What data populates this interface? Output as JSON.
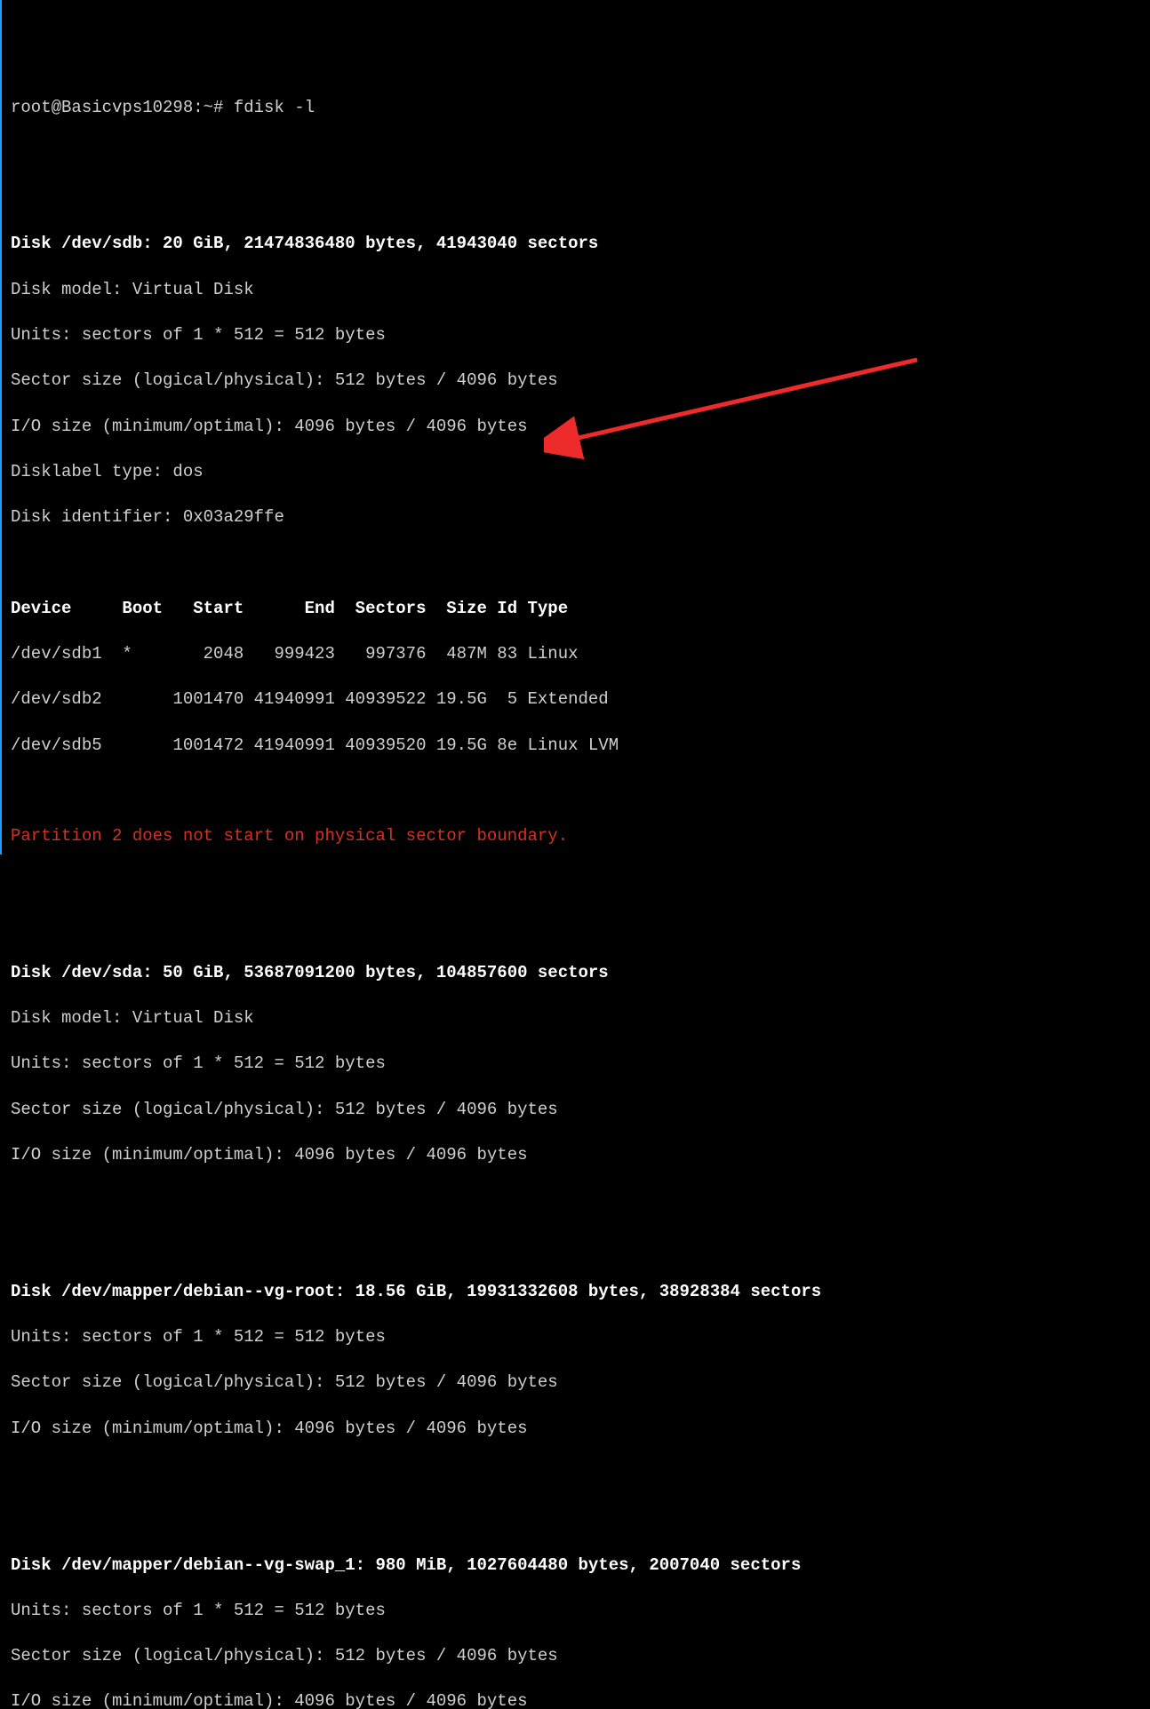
{
  "prompt": "root@Basicvps10298:~# fdisk -l",
  "disk_sdb": {
    "header": "Disk /dev/sdb: 20 GiB, 21474836480 bytes, 41943040 sectors",
    "model": "Disk model: Virtual Disk",
    "units": "Units: sectors of 1 * 512 = 512 bytes",
    "sector": "Sector size (logical/physical): 512 bytes / 4096 bytes",
    "io": "I/O size (minimum/optimal): 4096 bytes / 4096 bytes",
    "label": "Disklabel type: dos",
    "id": "Disk identifier: 0x03a29ffe",
    "table_header": "Device     Boot   Start      End  Sectors  Size Id Type",
    "rows": [
      "/dev/sdb1  *       2048   999423   997376  487M 83 Linux",
      "/dev/sdb2       1001470 41940991 40939522 19.5G  5 Extended",
      "/dev/sdb5       1001472 41940991 40939520 19.5G 8e Linux LVM"
    ]
  },
  "warning": "Partition 2 does not start on physical sector boundary.",
  "disk_sda": {
    "header": "Disk /dev/sda: 50 GiB, 53687091200 bytes, 104857600 sectors",
    "model": "Disk model: Virtual Disk",
    "units": "Units: sectors of 1 * 512 = 512 bytes",
    "sector": "Sector size (logical/physical): 512 bytes / 4096 bytes",
    "io": "I/O size (minimum/optimal): 4096 bytes / 4096 bytes"
  },
  "disk_vg_root": {
    "header": "Disk /dev/mapper/debian--vg-root: 18.56 GiB, 19931332608 bytes, 38928384 sectors",
    "units": "Units: sectors of 1 * 512 = 512 bytes",
    "sector": "Sector size (logical/physical): 512 bytes / 4096 bytes",
    "io": "I/O size (minimum/optimal): 4096 bytes / 4096 bytes"
  },
  "disk_vg_swap": {
    "header": "Disk /dev/mapper/debian--vg-swap_1: 980 MiB, 1027604480 bytes, 2007040 sectors",
    "units": "Units: sectors of 1 * 512 = 512 bytes",
    "sector": "Sector size (logical/physical): 512 bytes / 4096 bytes",
    "io": "I/O size (minimum/optimal): 4096 bytes / 4096 bytes"
  }
}
